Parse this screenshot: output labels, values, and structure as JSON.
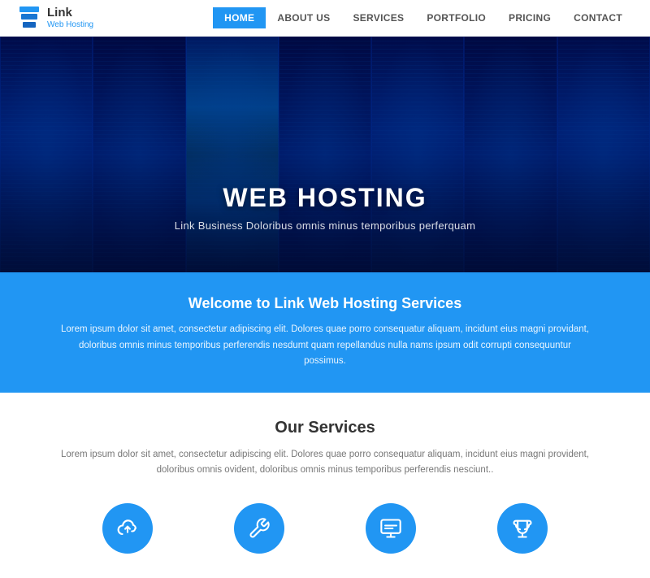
{
  "header": {
    "logo_name": "Link",
    "logo_sub": "Web Hosting",
    "nav_items": [
      {
        "label": "HOME",
        "active": true
      },
      {
        "label": "ABOUT US",
        "active": false
      },
      {
        "label": "SERVICES",
        "active": false
      },
      {
        "label": "PORTFOLIO",
        "active": false
      },
      {
        "label": "PRICING",
        "active": false
      },
      {
        "label": "CONTACT",
        "active": false
      }
    ]
  },
  "hero": {
    "title": "WEB HOSTING",
    "subtitle": "Link Business Doloribus omnis minus temporibus perferquam"
  },
  "blue_section": {
    "heading": "Welcome to Link Web Hosting Services",
    "body": "Lorem ipsum dolor sit amet, consectetur adipiscing elit. Dolores quae porro consequatur aliquam, incidunt eius magni providant, doloribus omnis minus temporibus perferendis nesdumt quam repellandus nulla nams ipsum odit corrupti consequuntur possimus."
  },
  "services_section": {
    "heading": "Our Services",
    "description": "Lorem ipsum dolor sit amet, consectetur adipiscing elit. Dolores quae porro consequatur aliquam, incidunt eius magni provident, doloribus omnis ovident, doloribus omnis minus temporibus perferendis nesciunt..",
    "icons": [
      {
        "name": "cloud-upload",
        "label": "Cloud"
      },
      {
        "name": "tools",
        "label": "Tools"
      },
      {
        "name": "display",
        "label": "Display"
      },
      {
        "name": "trophy",
        "label": "Trophy"
      }
    ]
  }
}
